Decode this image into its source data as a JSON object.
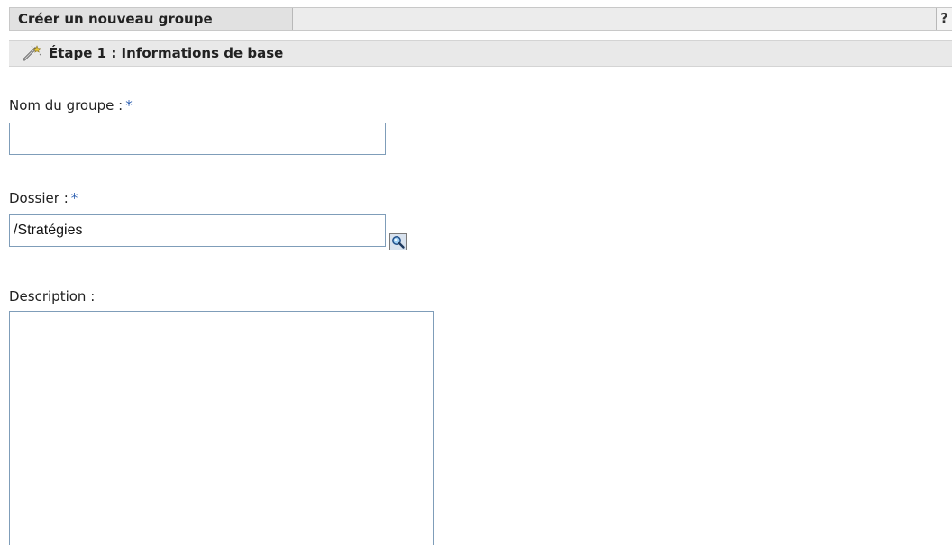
{
  "header": {
    "title": "Créer un nouveau groupe",
    "help_label": "?"
  },
  "step": {
    "title": "Étape 1 : Informations de base",
    "icon": "wand-icon"
  },
  "form": {
    "group_name": {
      "label": "Nom du groupe :",
      "required_marker": "*",
      "value": ""
    },
    "folder": {
      "label": "Dossier :",
      "required_marker": "*",
      "value": "/Stratégies",
      "browse_icon": "magnifier-icon"
    },
    "description": {
      "label": "Description :",
      "value": ""
    }
  },
  "colors": {
    "required_marker": "#2a5db0",
    "input_border": "#7f9db9",
    "header_background": "#e1e1e1"
  }
}
